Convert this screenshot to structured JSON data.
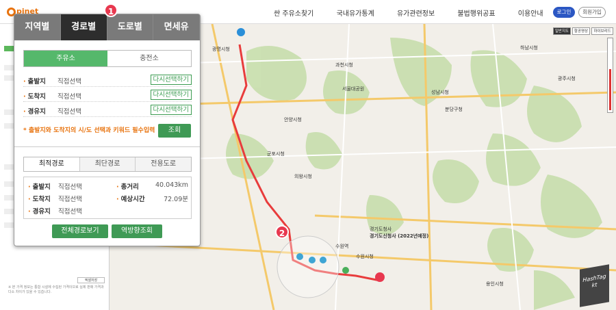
{
  "header": {
    "logo": "pinet",
    "nav": [
      "싼 주유소찾기",
      "국내유가통계",
      "유가관련정보",
      "불법행위공표",
      "이용안내"
    ],
    "login": "로그인",
    "join": "회원가입"
  },
  "sidebar": {
    "save_label": "엑셀저장",
    "note": "※ 본 가격 정보는 통합 시설에 수집된 가격이므로 실제 판매 가격과 다소 차이가 있을 수 있습니다."
  },
  "map": {
    "map_types": [
      "일반지도",
      "항공영상",
      "하이브리드"
    ],
    "active_map_type": "일반지도",
    "labels": [
      "광명시청",
      "과천시청",
      "안양시청",
      "군포시청",
      "의왕시청",
      "서울대공원",
      "성남시청",
      "분당구청",
      "수원시청",
      "용인시청",
      "광주시청",
      "경기도청사",
      "수원역",
      "하남시청",
      "경기도신청사 (2022년예정)"
    ],
    "brand_mark": "HashTag",
    "brand_sub": "kt",
    "badges": [
      "1",
      "2"
    ]
  },
  "panel": {
    "tabs": [
      "지역별",
      "경로별",
      "도로별",
      "면세유"
    ],
    "active_tab": "경로별",
    "fuel_tabs": [
      "주유소",
      "충전소"
    ],
    "active_fuel_tab": "주유소",
    "selectors": [
      {
        "label": "출발지",
        "value": "직접선택",
        "button": "다시선택하기"
      },
      {
        "label": "도착지",
        "value": "직접선택",
        "button": "다시선택하기"
      },
      {
        "label": "경유지",
        "value": "직접선택",
        "button": "다시선택하기"
      }
    ],
    "warning": "* 출발지와 도착지의 시/도 선택과 키워드 필수입력",
    "search_button": "조회",
    "route_tabs": [
      "최적경로",
      "최단경로",
      "전용도로"
    ],
    "active_route_tab": "최적경로",
    "result": {
      "start_label": "출발지",
      "start_value": "직접선택",
      "end_label": "도착지",
      "end_value": "직접선택",
      "via_label": "경유지",
      "via_value": "직접선택",
      "distance_label": "총거리",
      "distance_value": "40.043km",
      "time_label": "예상시간",
      "time_value": "72.09분"
    },
    "view_all_button": "전체경로보기",
    "reverse_button": "역방향조회"
  },
  "colors": {
    "active_tab": "#2d2d2d",
    "green": "#3f9a55",
    "orange": "#e8730e",
    "badge": "#e8384f",
    "route": "#e83c3c"
  }
}
